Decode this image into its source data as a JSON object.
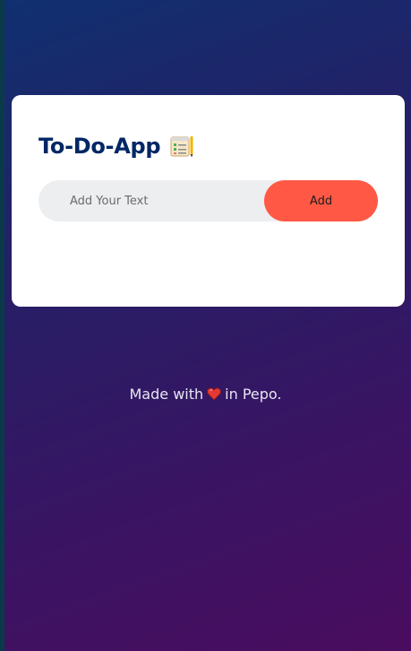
{
  "app": {
    "title": "To-Do-App",
    "title_icon": "notepad-icon"
  },
  "todo": {
    "input_placeholder": "Add Your Text",
    "input_value": "",
    "add_label": "Add"
  },
  "footer": {
    "prefix": "Made with",
    "icon": "heart-icon",
    "suffix": "in Pepo."
  },
  "colors": {
    "title": "#002765",
    "accent": "#ff5945",
    "input_bg": "#edeef0",
    "card_bg": "#ffffff",
    "footer_text": "#e8e6f2"
  }
}
